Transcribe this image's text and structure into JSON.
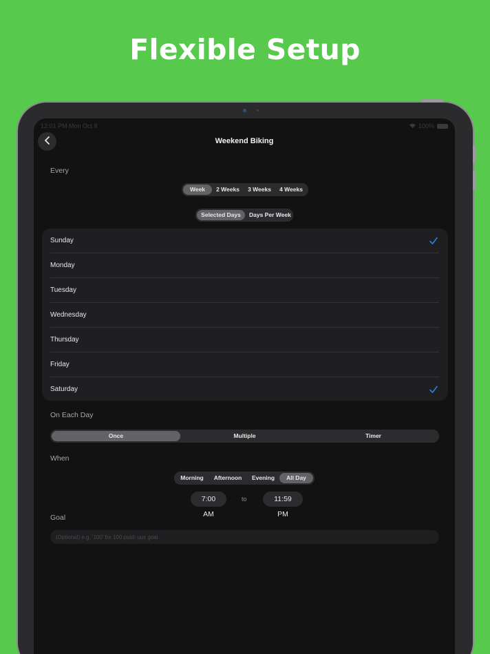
{
  "headline": "Flexible Setup",
  "status_bar": {
    "time": "12:01 PM  Mon Oct 8",
    "battery": "100%"
  },
  "nav": {
    "title": "Weekend Biking",
    "back_icon": "chevron-left-icon"
  },
  "every": {
    "label": "Every",
    "interval_options": [
      "Week",
      "2 Weeks",
      "3 Weeks",
      "4 Weeks"
    ],
    "interval_selected": "Week",
    "mode_options": [
      "Selected Days",
      "Days Per Week"
    ],
    "mode_selected": "Selected Days"
  },
  "days": [
    {
      "name": "Sunday",
      "checked": true
    },
    {
      "name": "Monday",
      "checked": false
    },
    {
      "name": "Tuesday",
      "checked": false
    },
    {
      "name": "Wednesday",
      "checked": false
    },
    {
      "name": "Thursday",
      "checked": false
    },
    {
      "name": "Friday",
      "checked": false
    },
    {
      "name": "Saturday",
      "checked": true
    }
  ],
  "on_each_day": {
    "label": "On Each Day",
    "options": [
      "Once",
      "Multiple",
      "Timer"
    ],
    "selected": "Once"
  },
  "when": {
    "label": "When",
    "options": [
      "Morning",
      "Afternoon",
      "Evening",
      "All Day"
    ],
    "selected": "All Day",
    "start_time": "7:00 AM",
    "to": "to",
    "end_time": "11:59 PM"
  },
  "goal": {
    "label": "Goal",
    "value": "",
    "placeholder": "(Optional) e.g. '100' for 100 push ups goal"
  },
  "colors": {
    "background": "#57c94c",
    "screen": "#121212",
    "accent": "#2f7fe0",
    "segment_active": "#636366"
  }
}
